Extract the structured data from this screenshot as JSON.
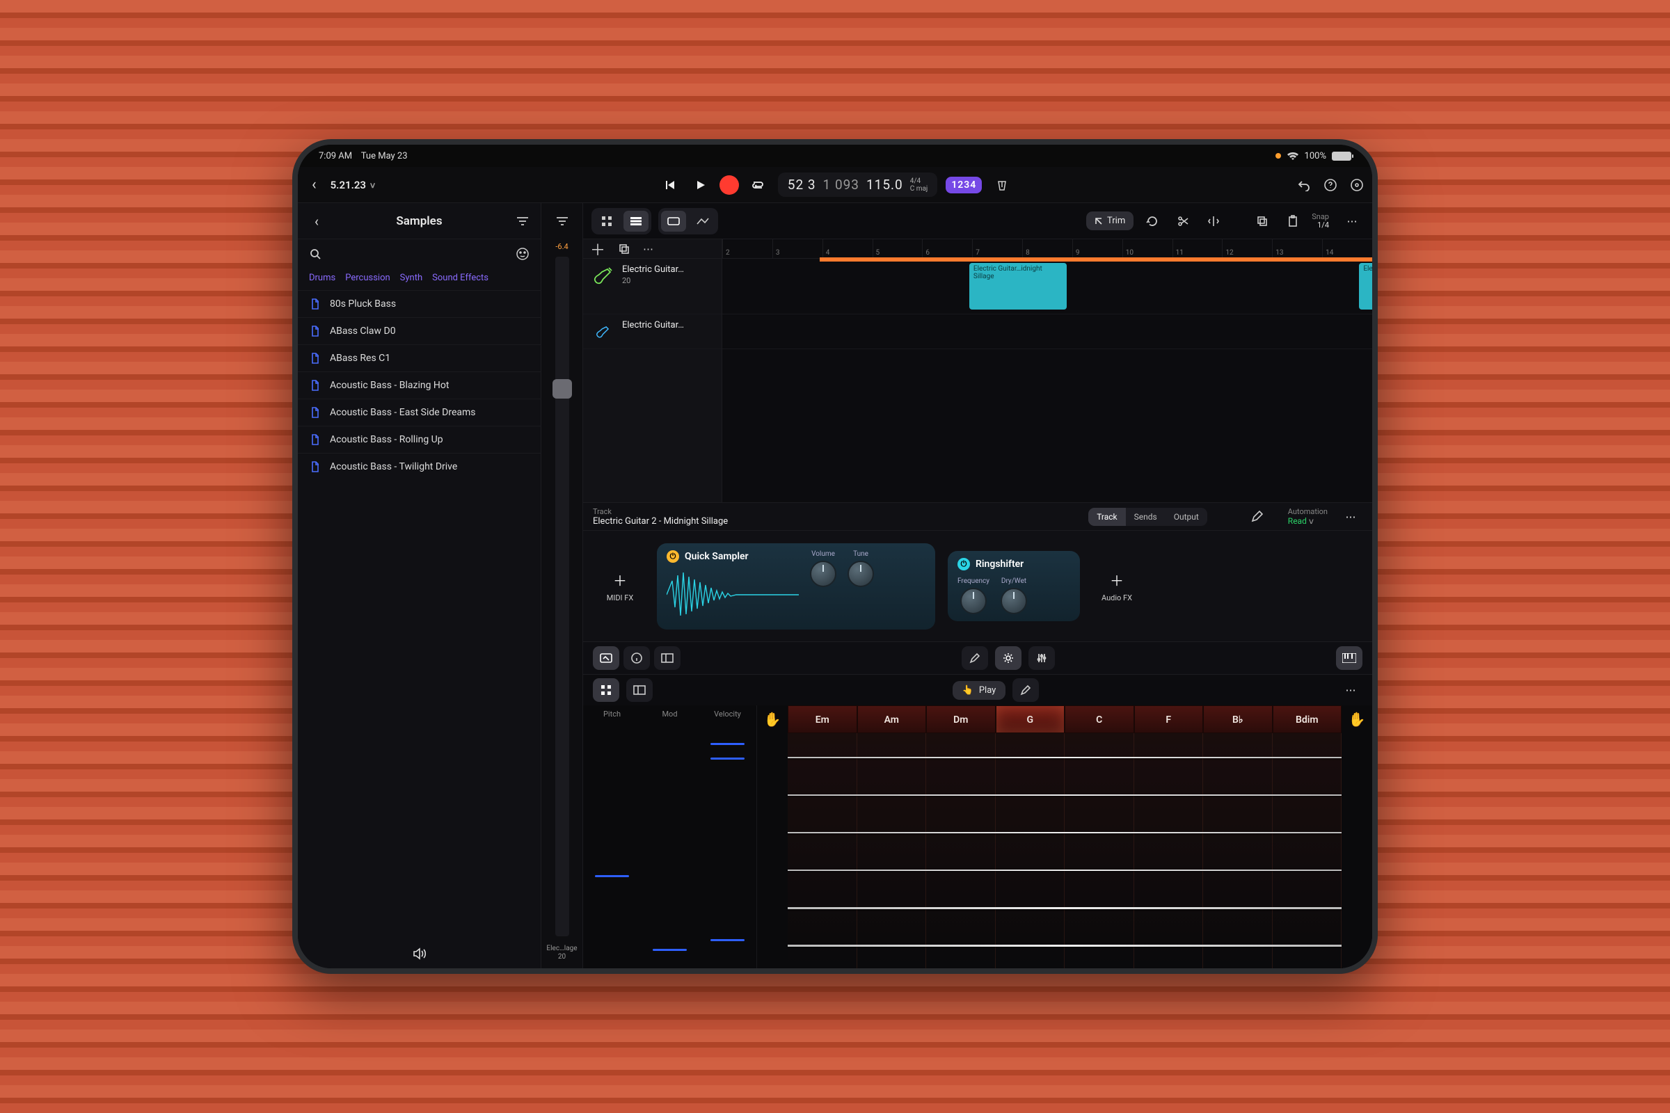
{
  "status": {
    "time": "7:09 AM",
    "date": "Tue May 23",
    "battery": "100%"
  },
  "header": {
    "project": "5.21.23",
    "lcd": {
      "bars": "52 3",
      "sub": "1 093",
      "tempo": "115.0",
      "sig": "4/4",
      "key": "C maj"
    },
    "beats": "1234"
  },
  "sidebar": {
    "title": "Samples",
    "chips": [
      "Drums",
      "Percussion",
      "Synth",
      "Sound Effects"
    ],
    "items": [
      "80s Pluck Bass",
      "ABass Claw D0",
      "ABass Res C1",
      "Acoustic Bass - Blazing Hot",
      "Acoustic Bass - East Side Dreams",
      "Acoustic Bass - Rolling Up",
      "Acoustic Bass - Twilight Drive"
    ]
  },
  "meter": {
    "db": "-6.4",
    "label": "Elec…lage",
    "label2": "20"
  },
  "toolbar": {
    "trim": "Trim",
    "snap_label": "Snap",
    "snap_value": "1/4"
  },
  "ruler": [
    "2",
    "3",
    "4",
    "5",
    "6",
    "7",
    "8",
    "9",
    "10",
    "11",
    "12",
    "13",
    "14"
  ],
  "tracks": {
    "t1": {
      "name": "Electric Guitar…",
      "num": "20",
      "region_label": "Electric Guitar…idnight Sillage"
    },
    "t2": {
      "name": "Electric Guitar…",
      "region2_label": "Electric"
    }
  },
  "inspector": {
    "track_label": "Track",
    "track_name": "Electric Guitar 2 - Midnight Sillage",
    "seg": [
      "Track",
      "Sends",
      "Output"
    ],
    "automation_label": "Automation",
    "automation_value": "Read",
    "midifx": "MIDI FX",
    "audiofx": "Audio FX",
    "plugin1": {
      "name": "Quick Sampler",
      "k1": "Volume",
      "k2": "Tune"
    },
    "plugin2": {
      "name": "Ringshifter",
      "k1": "Frequency",
      "k2": "Dry/Wet"
    }
  },
  "bottom": {
    "play": "Play",
    "ctrl_labels": [
      "Pitch",
      "Mod",
      "Velocity"
    ],
    "chords": [
      "Em",
      "Am",
      "Dm",
      "G",
      "C",
      "F",
      "B♭",
      "Bdim"
    ]
  }
}
